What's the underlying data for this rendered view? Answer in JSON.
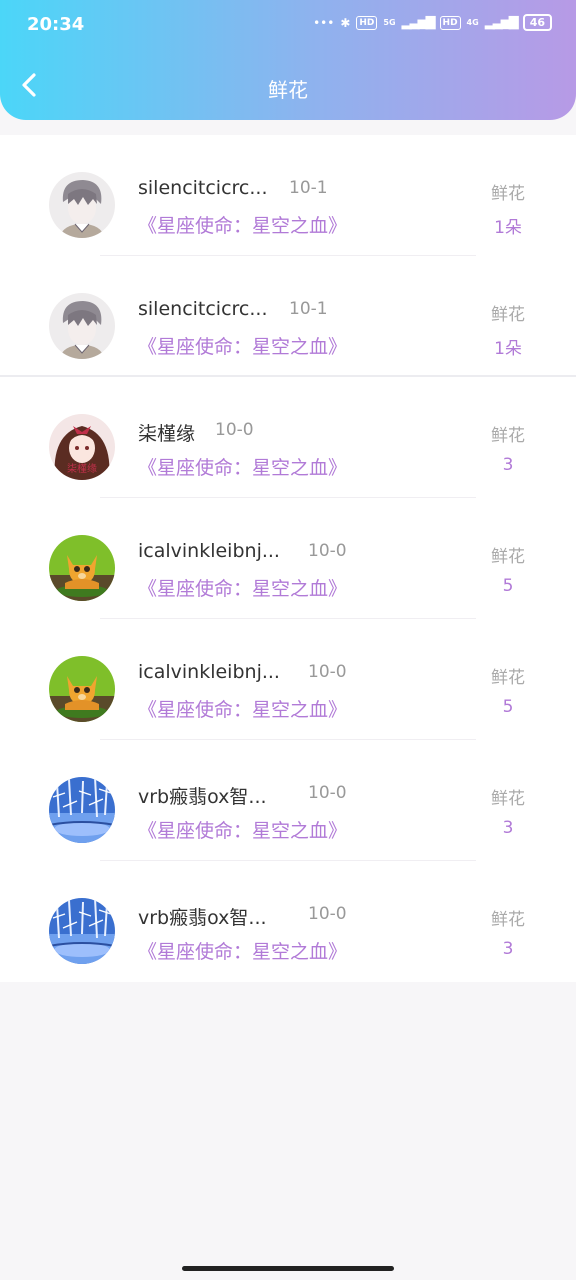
{
  "status_bar": {
    "time": "20:34",
    "signal_5g": "5G",
    "signal_4g": "4G",
    "hd": "HD",
    "battery": "46"
  },
  "header": {
    "title": "鲜花"
  },
  "rows": [
    {
      "name": "silencitcicrc...",
      "date": "10-1",
      "book": "《星座使命：星空之血》",
      "flower_label": "鲜花",
      "count": "1朵",
      "avatar": "anime-boy-avatar"
    },
    {
      "name": "silencitcicrc...",
      "date": "10-1",
      "book": "《星座使命：星空之血》",
      "flower_label": "鲜花",
      "count": "1朵",
      "avatar": "anime-boy-avatar"
    },
    {
      "name": "柒槿缘",
      "date": "10-0",
      "book": "《星座使命：星空之血》",
      "flower_label": "鲜花",
      "count": "3",
      "avatar": "anime-girl-avatar"
    },
    {
      "name": "icalvinkleibnj...",
      "date": "10-0",
      "book": "《星座使命：星空之血》",
      "flower_label": "鲜花",
      "count": "5",
      "avatar": "kitten-avatar"
    },
    {
      "name": "icalvinkleibnj...",
      "date": "10-0",
      "book": "《星座使命：星空之血》",
      "flower_label": "鲜花",
      "count": "5",
      "avatar": "kitten-avatar"
    },
    {
      "name": "vrb瘢翡ox智...",
      "date": "10-0",
      "book": "《星座使命：星空之血》",
      "flower_label": "鲜花",
      "count": "3",
      "avatar": "snow-forest-avatar"
    },
    {
      "name": "vrb瘢翡ox智...",
      "date": "10-0",
      "book": "《星座使命：星空之血》",
      "flower_label": "鲜花",
      "count": "3",
      "avatar": "snow-forest-avatar"
    }
  ],
  "colors": {
    "accent": "#b17ad7",
    "header_start": "#4bd6f8",
    "header_end": "#b79ae6"
  }
}
